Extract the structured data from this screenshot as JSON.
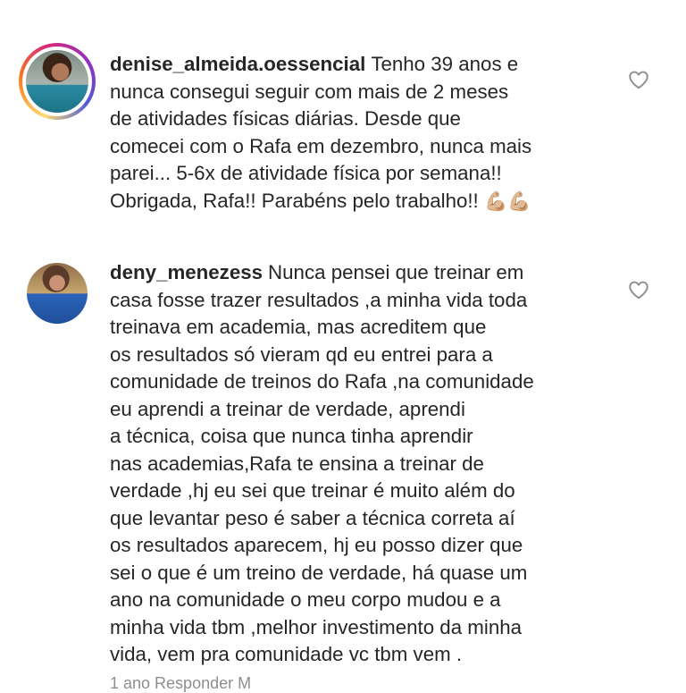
{
  "comments": [
    {
      "username": "denise_almeida.oessencial",
      "lines": [
        "Tenho 39 anos e",
        "nunca consegui seguir com mais de 2 meses",
        "de atividades físicas diárias. Desde que",
        "comecei com o Rafa em dezembro, nunca mais",
        "parei... 5-6x de atividade física por semana!!",
        "Obrigada, Rafa!! Parabéns pelo trabalho!! "
      ],
      "emoji": "💪🏼💪🏼",
      "like_icon": "heart-outline-icon"
    },
    {
      "username": "deny_menezess",
      "lines": [
        "Nunca pensei que  treinar em",
        "casa fosse trazer resultados ,a minha vida toda",
        "treinava em academia, mas acreditem que",
        "os resultados  só vieram qd eu entrei para a",
        "comunidade de treinos do Rafa ,na comunidade",
        "eu aprendi a  treinar de verdade, aprendi",
        "a técnica, coisa que nunca tinha aprendir",
        "nas academias,Rafa te ensina a treinar de",
        "verdade ,hj eu sei que treinar é  muito além  do",
        "que  levantar  peso é  saber a técnica correta aí",
        "os resultados  aparecem, hj eu posso  dizer que",
        "sei o que é  um treino de verdade, há  quase um",
        "ano na comunidade o meu corpo mudou e  a",
        "minha vida tbm ,melhor  investimento da minha",
        "vida, vem pra comunidade  vc tbm vem ."
      ],
      "like_icon": "heart-outline-icon"
    }
  ],
  "footer_peek": "1 ano   Responder   M"
}
